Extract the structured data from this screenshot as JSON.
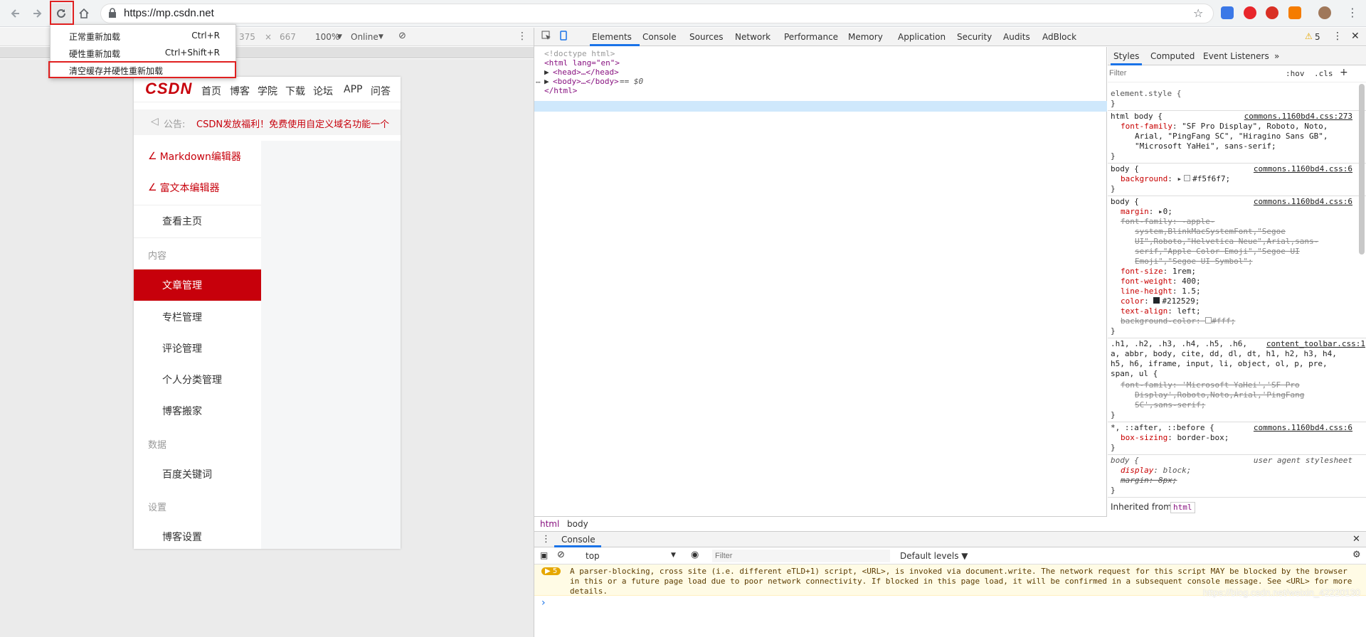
{
  "browser": {
    "url": "https://mp.csdn.net",
    "reload_menu": {
      "items": [
        {
          "label": "正常重新加载",
          "shortcut": "Ctrl+R"
        },
        {
          "label": "硬性重新加载",
          "shortcut": "Ctrl+Shift+R"
        },
        {
          "label": "清空缓存并硬性重新加载",
          "shortcut": ""
        }
      ]
    }
  },
  "device_toolbar": {
    "width": "375",
    "x": "×",
    "height": "667",
    "zoom": "100%",
    "network": "Online"
  },
  "page": {
    "logo": "CSDN",
    "nav": [
      "首页",
      "博客",
      "学院",
      "下载",
      "论坛",
      "APP",
      "问答"
    ],
    "notice_label": "公告:",
    "notice_text": "CSDN发放福利！免费使用自定义域名功能一个",
    "editors": [
      "Markdown编辑器",
      "富文本编辑器"
    ],
    "home": "查看主页",
    "sections": [
      {
        "title": "内容",
        "items": [
          "文章管理",
          "专栏管理",
          "评论管理",
          "个人分类管理",
          "博客搬家"
        ]
      },
      {
        "title": "数据",
        "items": [
          "百度关键词"
        ]
      },
      {
        "title": "设置",
        "items": [
          "博客设置"
        ]
      }
    ],
    "active_item": "文章管理"
  },
  "devtools": {
    "tabs": [
      "Elements",
      "Console",
      "Sources",
      "Network",
      "Performance",
      "Memory",
      "Application",
      "Security",
      "Audits",
      "AdBlock"
    ],
    "warning_count": "5",
    "elements_lines": [
      "<!doctype html>",
      "<html lang=\"en\">",
      "<head>…</head>",
      "<body>…</body>",
      "== $0",
      "</html>"
    ],
    "breadcrumbs": [
      "html",
      "body"
    ],
    "styles_tabs": [
      "Styles",
      "Computed",
      "Event Listeners",
      "»"
    ],
    "styles_filter_placeholder": "Filter",
    "hov": ":hov",
    "cls": ".cls",
    "inherited_from_label": "Inherited from",
    "inherited_from_tag": "html",
    "rules": {
      "element_style": "element.style {",
      "r1_sel": "html body {",
      "r1_src": "commons.1160bd4.css:273",
      "r1_prop": "font-family",
      "r1_val1": "\"SF Pro Display\", Roboto, Noto,",
      "r1_val2": "Arial, \"PingFang SC\", \"Hiragino Sans GB\",",
      "r1_val3": "\"Microsoft YaHei\", sans-serif;",
      "r2_sel": "body {",
      "r2_src": "commons.1160bd4.css:6",
      "r2_prop": "background",
      "r2_val": "#f5f6f7;",
      "r3_sel": "body {",
      "r3_src": "commons.1160bd4.css:6",
      "r3_margin": "margin",
      "r3_margin_val": "0;",
      "r3_ff": "font-family: -apple-",
      "r3_ff2": "system,BlinkMacSystemFont,\"Segoe",
      "r3_ff3": "UI\",Roboto,\"Helvetica Neue\",Arial,sans-",
      "r3_ff4": "serif,\"Apple Color Emoji\",\"Segoe UI",
      "r3_ff5": "Emoji\",\"Segoe UI Symbol\";",
      "r3_fs": "font-size",
      "r3_fs_val": "1rem;",
      "r3_fw": "font-weight",
      "r3_fw_val": "400;",
      "r3_lh": "line-height",
      "r3_lh_val": "1.5;",
      "r3_color": "color",
      "r3_color_val": "#212529;",
      "r3_ta": "text-align",
      "r3_ta_val": "left;",
      "r3_bg": "background-color:",
      "r3_bg_val": "#fff;",
      "r4_sel1": ".h1, .h2, .h3, .h4, .h5, .h6,",
      "r4_src": "content_toolbar.css:1",
      "r4_sel2": "a, abbr, body, cite, dd, dl, dt, h1, h2, h3, h4,",
      "r4_sel3": "h5, h6, iframe, input, li, object, ol, p, pre,",
      "r4_sel4": "span, ul {",
      "r4_ff1": "font-family: 'Microsoft YaHei','SF Pro",
      "r4_ff2": "Display',Roboto,Noto,Arial,'PingFang",
      "r4_ff3": "SC',sans-serif;",
      "r5_sel": "*, ::after, ::before {",
      "r5_src": "commons.1160bd4.css:6",
      "r5_prop": "box-sizing",
      "r5_val": "border-box;",
      "r6_sel": "body {",
      "r6_src": "user agent stylesheet",
      "r6_prop": "display",
      "r6_val": "block;",
      "r6_margin": "margin: 8px;",
      "close": "}"
    },
    "console": {
      "tab": "Console",
      "context": "top",
      "filter_placeholder": "Filter",
      "levels": "Default levels ▼",
      "warn_badge": "▶ 5",
      "warning": "A parser-blocking, cross site (i.e. different eTLD+1) script, <URL>, is invoked via document.write. The network request for this script MAY be blocked by the browser in this or a future page load due to poor network connectivity. If blocked in this page load, it will be confirmed in a subsequent console message. See <URL> for more details.",
      "prompt": "›"
    }
  },
  "watermark": "https://blog.csdn.net/weixin_42220130",
  "colors": {
    "brand_red": "#c7000b",
    "devtools_blue": "#1a73e8"
  }
}
